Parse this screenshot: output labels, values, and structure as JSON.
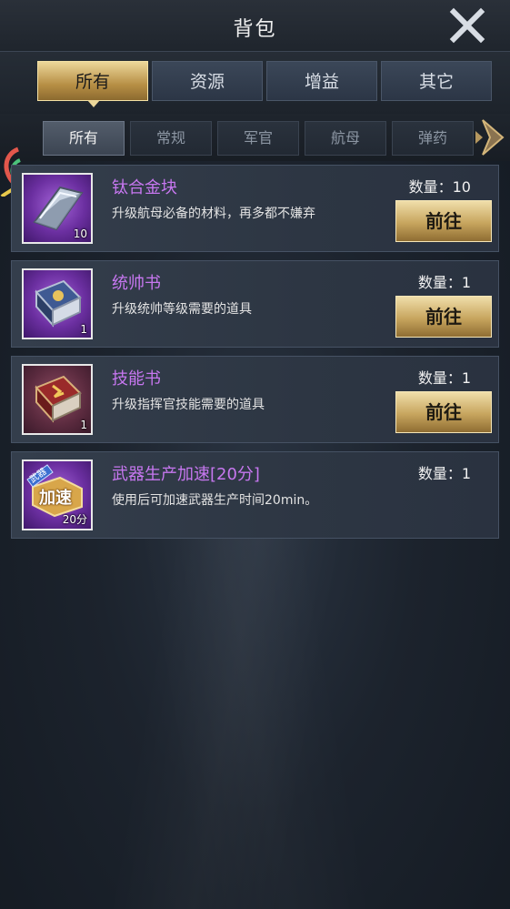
{
  "header": {
    "title": "背包"
  },
  "tabs": [
    {
      "label": "所有",
      "active": true
    },
    {
      "label": "资源",
      "active": false
    },
    {
      "label": "增益",
      "active": false
    },
    {
      "label": "其它",
      "active": false
    }
  ],
  "subtabs": [
    {
      "label": "所有",
      "active": true
    },
    {
      "label": "常规",
      "active": false
    },
    {
      "label": "军官",
      "active": false
    },
    {
      "label": "航母",
      "active": false
    },
    {
      "label": "弹药",
      "active": false
    }
  ],
  "items": [
    {
      "name": "钛合金块",
      "desc": "升级航母必备的材料，再多都不嫌弃",
      "qty": "数量：10",
      "count": "10",
      "go": "前往",
      "icon": "titanium-ingot-icon"
    },
    {
      "name": "统帅书",
      "desc": "升级统帅等级需要的道具",
      "qty": "数量：1",
      "count": "1",
      "go": "前往",
      "icon": "commander-book-icon"
    },
    {
      "name": "技能书",
      "desc": "升级指挥官技能需要的道具",
      "qty": "数量：1",
      "count": "1",
      "go": "前往",
      "icon": "skill-book-icon"
    },
    {
      "name": "武器生产加速[20分]",
      "desc": "使用后可加速武器生产时间20min。",
      "qty": "数量：1",
      "count": "20分",
      "icon": "speedup-icon",
      "speedup_main": "加速",
      "speedup_tag": "武器"
    }
  ],
  "colors": {
    "accent_gold": "#c7a55e",
    "item_name": "#c777f0"
  }
}
